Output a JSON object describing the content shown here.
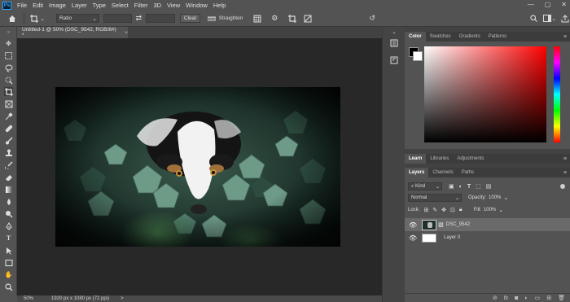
{
  "app": {
    "logo": "Ps"
  },
  "menu": [
    "File",
    "Edit",
    "Image",
    "Layer",
    "Type",
    "Select",
    "Filter",
    "3D",
    "View",
    "Window",
    "Help"
  ],
  "window_controls": {
    "minimize": "—",
    "maximize": "▢",
    "close": "✕"
  },
  "options": {
    "ratio_label": "Ratio",
    "clear_label": "Clear",
    "straighten_label": "Straighten"
  },
  "document": {
    "tab_title": "Untitled-1 @ 50% (DSC_9542, RGB/8#) *",
    "close_glyph": "×"
  },
  "status": {
    "zoom": "50%",
    "doc_info": "1920 px x 1080 px (72 ppi)",
    "arrow": ">"
  },
  "color_panel": {
    "tabs": [
      "Color",
      "Swatches",
      "Gradients",
      "Patterns"
    ],
    "active_tab": 0
  },
  "learn_panel": {
    "tabs": [
      "Learn",
      "Libraries",
      "Adjustments"
    ],
    "active_tab": 0
  },
  "layers_panel": {
    "tabs": [
      "Layers",
      "Channels",
      "Paths"
    ],
    "active_tab": 0,
    "filter_kind": "Kind",
    "blend_mode": "Normal",
    "opacity_label": "Opacity:",
    "opacity_value": "100%",
    "lock_label": "Lock:",
    "fill_label": "Fill:",
    "fill_value": "100%",
    "layers": [
      {
        "name": "DSC_9542",
        "selected": true
      },
      {
        "name": "Layer 0",
        "selected": false
      }
    ]
  },
  "colors": {
    "accent": "#31a8ff",
    "hue_base": "#ff0000",
    "panel_bg": "#535353",
    "canvas_bg": "#282828"
  }
}
